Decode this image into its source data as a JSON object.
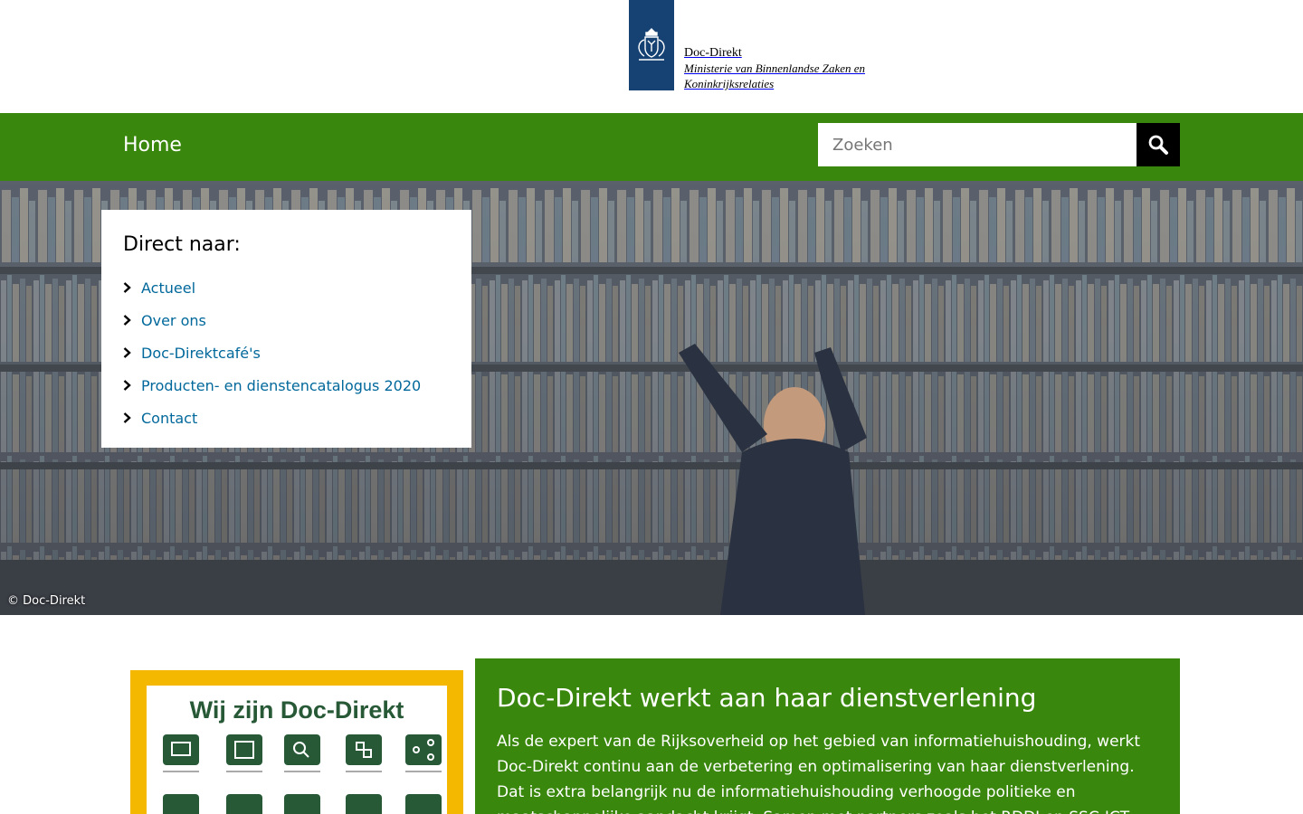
{
  "header": {
    "logo": {
      "name": "Doc-Direkt",
      "ministry_line1": "Ministerie van Binnenlandse Zaken en",
      "ministry_line2": "Koninkrijksrelaties"
    }
  },
  "nav": {
    "home_label": "Home",
    "search_placeholder": "Zoeken",
    "search_icon": "magnifier-icon"
  },
  "hero": {
    "credit": "© Doc-Direkt",
    "direct": {
      "title": "Direct naar:",
      "items": [
        {
          "label": "Actueel"
        },
        {
          "label": "Over ons"
        },
        {
          "label": "Doc-Direktcafé's"
        },
        {
          "label": "Producten- en dienstencatalogus 2020"
        },
        {
          "label": "Contact"
        }
      ]
    }
  },
  "promo": {
    "image_title": "Wij zijn Doc-Direkt",
    "title": "Doc-Direkt werkt aan haar dienstverlening",
    "body": "Als de expert van de Rijksoverheid op het gebied van informatiehuishouding, werkt Doc-Direkt continu aan de verbetering en optimalisering van haar dienstverlening. Dat is extra belangrijk nu de informatiehuishouding verhoogde politieke en maatschappelijke aandacht krijgt. Samen met partners zoals het RDDI en SSC-ICT"
  },
  "colors": {
    "brand_green": "#39870c",
    "rijks_blue": "#154273",
    "link_blue": "#01689b",
    "promo_yellow": "#f5b800",
    "promo_dark_green": "#275937"
  }
}
